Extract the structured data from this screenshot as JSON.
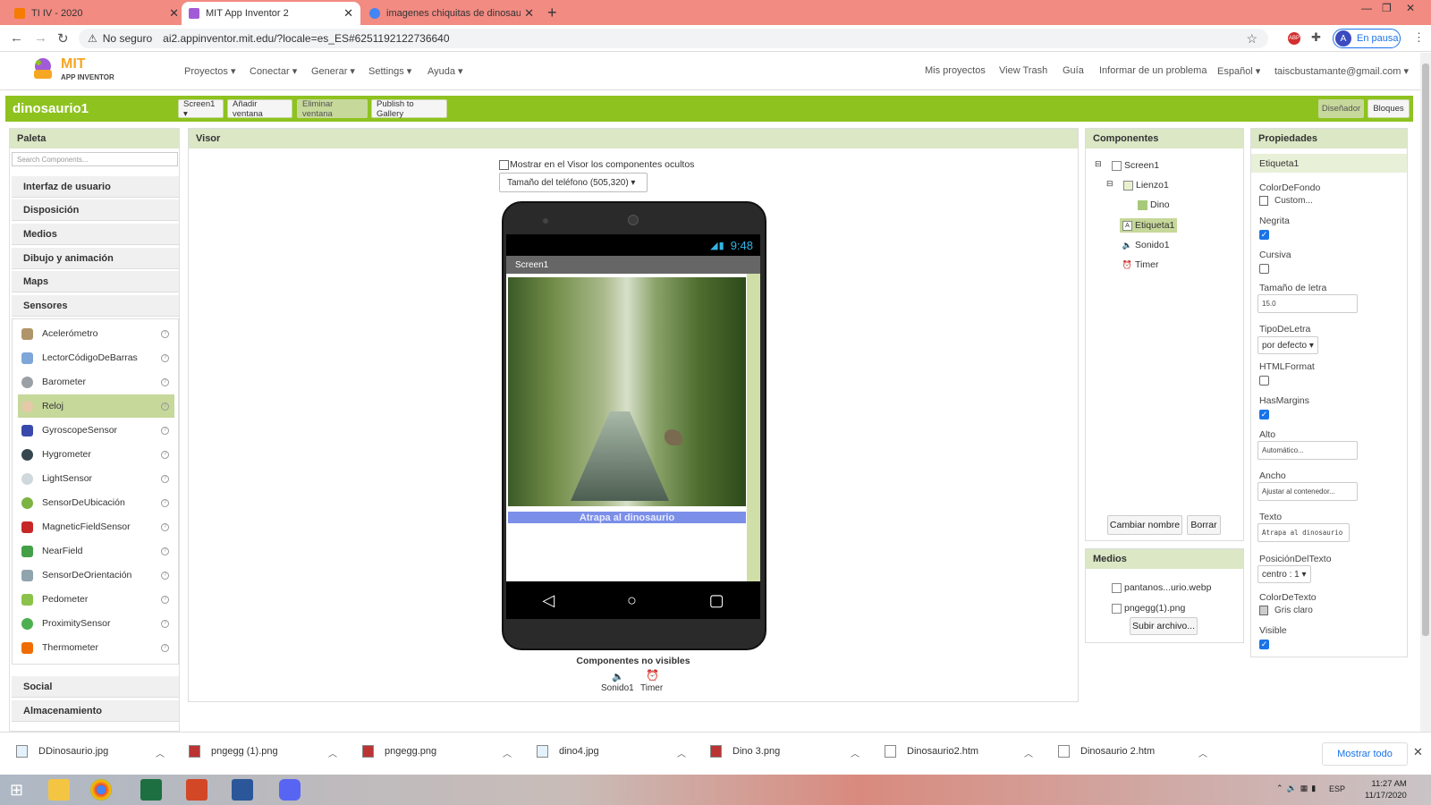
{
  "browser": {
    "tabs": [
      {
        "title": "TI IV - 2020",
        "favicon_color": "#f57c00"
      },
      {
        "title": "MIT App Inventor 2",
        "favicon_color": "#a25bd6"
      },
      {
        "title": "imagenes chiquitas de dinosaurio",
        "favicon_color": "#4285f4"
      }
    ],
    "security": "No seguro",
    "url": "ai2.appinventor.mit.edu/?locale=es_ES#6251192122736640",
    "profile_initial": "A",
    "profile_status": "En pausa"
  },
  "appinventor": {
    "logo_title": "MIT",
    "logo_subtitle": "APP INVENTOR",
    "menu_left": [
      "Proyectos ▾",
      "Conectar ▾",
      "Generar ▾",
      "Settings ▾",
      "Ayuda ▾"
    ],
    "menu_right": [
      "Mis proyectos",
      "View Trash",
      "Guía",
      "Informar de un problema",
      "Español ▾",
      "taiscbustamante@gmail.com ▾"
    ],
    "project_name": "dinosaurio1",
    "toolbar": {
      "screen_select": "Screen1 ▾",
      "add_screen": "Añadir ventana",
      "remove_screen": "Eliminar ventana",
      "publish": "Publish to Gallery",
      "designer": "Diseñador",
      "blocks": "Bloques"
    },
    "palette": {
      "title": "Paleta",
      "search_placeholder": "Search Components...",
      "categories_top": [
        "Interfaz de usuario",
        "Disposición",
        "Medios",
        "Dibujo y animación",
        "Maps",
        "Sensores"
      ],
      "sensors": [
        "Acelerómetro",
        "LectorCódigoDeBarras",
        "Barometer",
        "Reloj",
        "GyroscopeSensor",
        "Hygrometer",
        "LightSensor",
        "SensorDeUbicación",
        "MagneticFieldSensor",
        "NearField",
        "SensorDeOrientación",
        "Pedometer",
        "ProximitySensor",
        "Thermometer"
      ],
      "selected_sensor": "Reloj",
      "categories_bottom": [
        "Social",
        "Almacenamiento"
      ]
    },
    "viewer": {
      "title": "Visor",
      "show_hidden_label": "Mostrar en el Visor los componentes ocultos",
      "size_select": "Tamaño del teléfono (505,320) ▾",
      "status_time": "9:48",
      "screen_title": "Screen1",
      "label_text": "Atrapa al dinosaurio",
      "nonvisible_title": "Componentes no visibles",
      "nonvisible": [
        "Sonido1",
        "Timer"
      ]
    },
    "components": {
      "title": "Componentes",
      "tree": [
        "Screen1",
        "Lienzo1",
        "Dino",
        "Etiqueta1",
        "Sonido1",
        "Timer"
      ],
      "selected": "Etiqueta1",
      "rename": "Cambiar nombre",
      "delete": "Borrar"
    },
    "media": {
      "title": "Medios",
      "files": [
        "pantanos...urio.webp",
        "pngegg(1).png"
      ],
      "upload": "Subir archivo..."
    },
    "properties": {
      "title": "Propiedades",
      "component": "Etiqueta1",
      "bg_color_label": "ColorDeFondo",
      "bg_color_value": "Custom...",
      "bold_label": "Negrita",
      "bold": true,
      "italic_label": "Cursiva",
      "italic": false,
      "font_size_label": "Tamaño de letra",
      "font_size": "15.0",
      "font_type_label": "TipoDeLetra",
      "font_type": "por defecto ▾",
      "html_label": "HTMLFormat",
      "html": false,
      "margins_label": "HasMargins",
      "margins": true,
      "height_label": "Alto",
      "height": "Automático...",
      "width_label": "Ancho",
      "width": "Ajustar al contenedor...",
      "text_label": "Texto",
      "text": "Atrapa al dinosaurio",
      "align_label": "PosiciónDelTexto",
      "align": "centro : 1 ▾",
      "text_color_label": "ColorDeTexto",
      "text_color": "Gris claro",
      "visible_label": "Visible",
      "visible": true
    }
  },
  "downloads": {
    "files": [
      "DDinosaurio.jpg",
      "pngegg (1).png",
      "pngegg.png",
      "dino4.jpg",
      "Dino 3.png",
      "Dinosaurio2.htm",
      "Dinosaurio 2.htm"
    ],
    "show_all": "Mostrar todo"
  },
  "taskbar": {
    "lang": "ESP",
    "time": "11:27 AM",
    "date": "11/17/2020"
  },
  "colors": {
    "accent_green": "#8ec21f",
    "panel_head": "#dbe7c5",
    "tab_bar": "#f28b82",
    "label_bg": "#7b8ee8"
  }
}
